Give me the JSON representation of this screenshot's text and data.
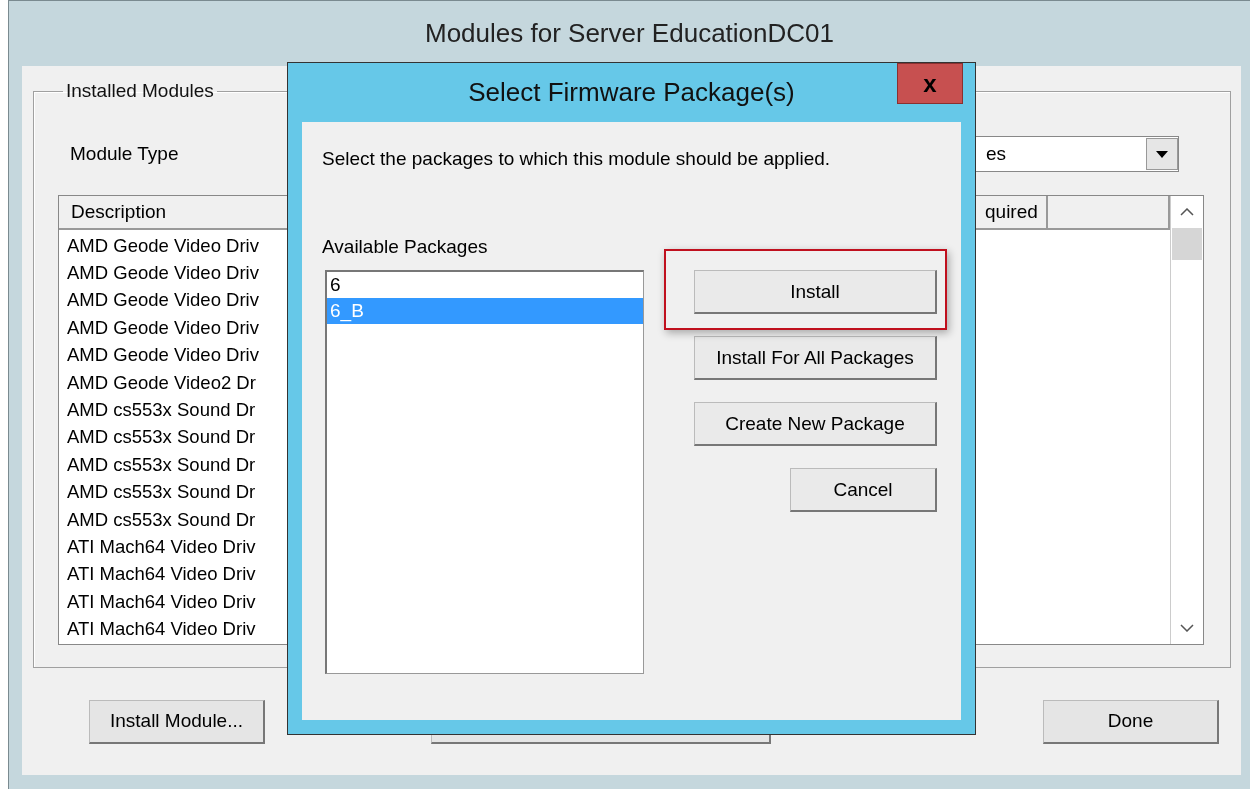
{
  "window": {
    "title": "Modules for Server EducationDC01"
  },
  "group": {
    "title": "Installed Modules",
    "module_type": {
      "label": "Module Type",
      "value": "es"
    },
    "list": {
      "columns": [
        "Description",
        "quired",
        ""
      ],
      "rows": [
        "AMD Geode Video Driv",
        "AMD Geode Video Driv",
        "AMD Geode Video Driv",
        "AMD Geode Video Driv",
        "AMD Geode Video Driv",
        "AMD Geode Video2 Dr",
        "AMD cs553x Sound Dr",
        "AMD cs553x Sound Dr",
        "AMD cs553x Sound Dr",
        "AMD cs553x Sound Dr",
        "AMD cs553x Sound Dr",
        "ATI Mach64 Video Driv",
        "ATI Mach64 Video Driv",
        "ATI Mach64 Video Driv",
        "ATI Mach64 Video Driv"
      ]
    }
  },
  "bottom_buttons": [
    {
      "kind": "text",
      "label": "Install Module..."
    },
    {
      "kind": "covered"
    },
    {
      "kind": "text",
      "label": "Done"
    }
  ],
  "dialog": {
    "title": "Select Firmware Package(s)",
    "close": "x",
    "prompt": "Select the packages to which this module should be applied.",
    "list_label": "Available Packages",
    "packages": [
      {
        "label": "6",
        "selected": false
      },
      {
        "label": "6_B",
        "selected": true
      }
    ],
    "buttons": [
      {
        "label": "Install",
        "highlighted": true,
        "kind": "wide"
      },
      {
        "label": "Install For All Packages",
        "highlighted": false,
        "kind": "wide"
      },
      {
        "label": "Create New Package",
        "highlighted": false,
        "kind": "wide"
      },
      {
        "label": "Cancel",
        "highlighted": false,
        "kind": "narrow"
      }
    ]
  }
}
